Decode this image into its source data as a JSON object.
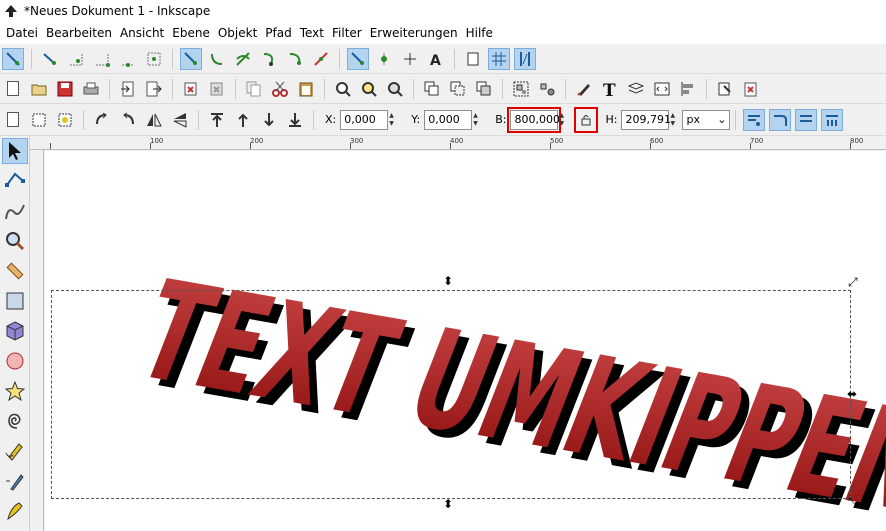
{
  "window": {
    "title": "*Neues Dokument 1 - Inkscape"
  },
  "menu": [
    "Datei",
    "Bearbeiten",
    "Ansicht",
    "Ebene",
    "Objekt",
    "Pfad",
    "Text",
    "Filter",
    "Erweiterungen",
    "Hilfe"
  ],
  "toolbar3": {
    "x_label": "X:",
    "x_value": "0,000",
    "y_label": "Y:",
    "y_value": "0,000",
    "w_label": "B:",
    "w_value": "800,000",
    "h_label": "H:",
    "h_value": "209,791",
    "unit": "px"
  },
  "ruler": {
    "h_labels": [
      "100",
      "200",
      "300",
      "400",
      "500",
      "600",
      "700",
      "800"
    ]
  },
  "canvas_text": "TEXT UMKIPPEN",
  "colors": {
    "text_top": "#c94545",
    "text_bottom": "#8e0f0f",
    "shadow": "#000000",
    "highlight": "#e00000",
    "active": "#b4d3ef"
  }
}
